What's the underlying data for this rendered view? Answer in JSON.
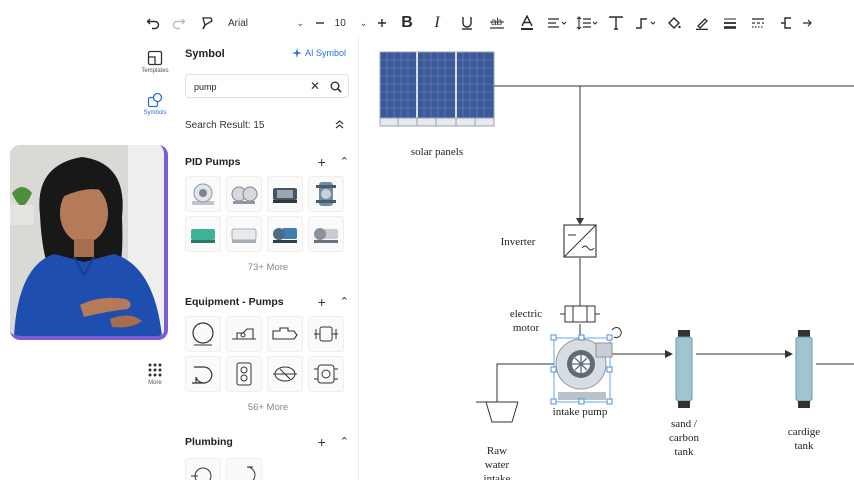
{
  "toolbar": {
    "font_family": "Arial",
    "font_size": "10",
    "icons": [
      "undo-icon",
      "redo-icon",
      "format-painter-icon",
      "font-select",
      "decrease-size-icon",
      "font-size",
      "increase-size-icon",
      "bold-icon",
      "italic-icon",
      "underline-icon",
      "strikethrough-icon",
      "font-color-icon",
      "align-icon",
      "line-spacing-icon",
      "text-icon",
      "connector-icon",
      "fill-icon",
      "line-color-icon",
      "line-weight-icon",
      "line-style-icon",
      "arrow-style-icon"
    ]
  },
  "rail": {
    "items": [
      {
        "label": "Templates",
        "icon": "templates-icon",
        "active": false
      },
      {
        "label": "Symbols",
        "icon": "symbols-icon",
        "active": true
      },
      {
        "label": "More",
        "icon": "more-grid-icon",
        "active": false
      }
    ]
  },
  "panel": {
    "title": "Symbol",
    "ai_label": "AI Symbol",
    "search_value": "pump",
    "result_text": "Search Result: 15",
    "sections": [
      {
        "title": "PID Pumps",
        "more": "73+ More"
      },
      {
        "title": "Equipment - Pumps",
        "more": "56+ More"
      },
      {
        "title": "Plumbing"
      }
    ]
  },
  "diagram": {
    "labels": {
      "solar": "solar panels",
      "inverter": "Inverter",
      "motor_1": "electric",
      "motor_2": "motor",
      "pump": "intake pump",
      "sand_1": "sand /",
      "sand_2": "carbon",
      "sand_3": "tank",
      "cartridge_1": "cardige",
      "cartridge_2": "tank",
      "raw_1": "Raw",
      "raw_2": "water",
      "raw_3": "intake"
    }
  },
  "colors": {
    "accent": "#2a6fd6",
    "webcam_border": "#7b5cd6",
    "panel_blue": "#3b5998",
    "tank_fill": "#9fc6d0"
  }
}
